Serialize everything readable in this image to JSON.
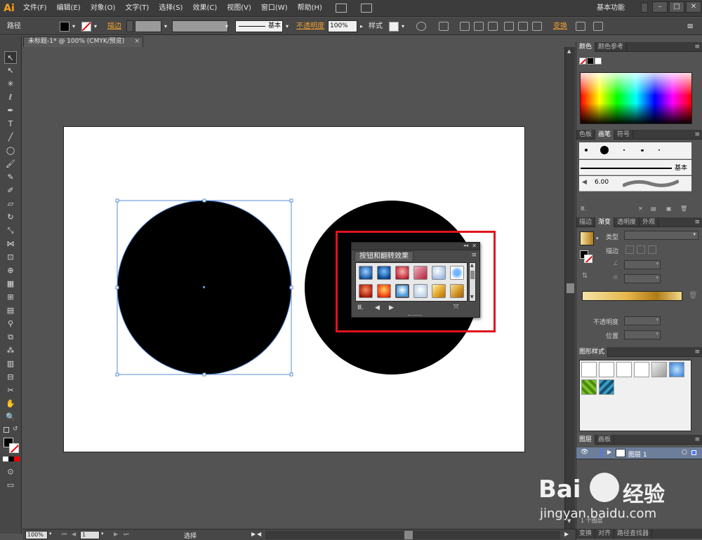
{
  "app": {
    "logo": "Ai",
    "menu": [
      "文件(F)",
      "编辑(E)",
      "对象(O)",
      "文字(T)",
      "选择(S)",
      "效果(C)",
      "视图(V)",
      "窗口(W)",
      "帮助(H)"
    ],
    "workspace": "基本功能",
    "window_buttons": [
      "–",
      "□",
      "✕"
    ]
  },
  "controlbar": {
    "selection_label": "路径",
    "stroke_label": "描边",
    "stroke_style": "基本",
    "opacity_label": "不透明度",
    "opacity_value": "100%",
    "style_label": "样式",
    "transform_label": "变换"
  },
  "document": {
    "tab_title": "未标题-1* @ 100% (CMYK/预览)",
    "tab_close": "×"
  },
  "statusbar": {
    "zoom": "100%",
    "artboard_index": "1",
    "tool_name": "选择"
  },
  "float_panel": {
    "title": "按钮和翻转效果",
    "icons": [
      "library-menu-icon",
      "prev-arrow-icon",
      "next-arrow-icon",
      "break-link-icon"
    ]
  },
  "panels": {
    "color": {
      "tabs": [
        "颜色",
        "颜色参考"
      ]
    },
    "brushes": {
      "tabs": [
        "色板",
        "画笔",
        "符号"
      ],
      "basic_label": "基本",
      "size_label": "6.00"
    },
    "gradient": {
      "tabs": [
        "描边",
        "渐变",
        "透明度",
        "外观"
      ],
      "type_label": "类型",
      "stroke_label": "描边",
      "opacity_label": "不透明度",
      "position_label": "位置"
    },
    "graphic_styles": {
      "tabs": [
        "图形样式"
      ]
    },
    "layers": {
      "tabs": [
        "图层",
        "画板"
      ],
      "layer_name": "图层 1",
      "footer": "1 个图层"
    },
    "bottom_tabs": [
      "变换",
      "对齐",
      "路径查找器"
    ]
  },
  "watermark": {
    "brand_pre": "Bai",
    "brand_post": "经验",
    "url": "jingyan.baidu.com"
  }
}
